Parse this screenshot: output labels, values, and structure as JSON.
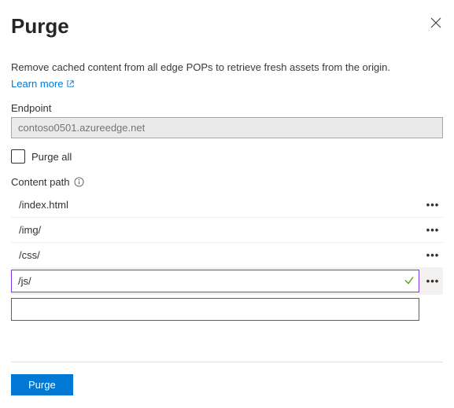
{
  "header": {
    "title": "Purge"
  },
  "description": "Remove cached content from all edge POPs to retrieve fresh assets from the origin.",
  "learn_more": "Learn more",
  "endpoint": {
    "label": "Endpoint",
    "value": "contoso0501.azureedge.net"
  },
  "purge_all": {
    "label": "Purge all",
    "checked": false
  },
  "content_path": {
    "label": "Content path",
    "rows": [
      {
        "value": "/index.html",
        "editing": false
      },
      {
        "value": "/img/",
        "editing": false
      },
      {
        "value": "/css/",
        "editing": false
      },
      {
        "value": "/js/",
        "editing": true,
        "valid": true
      }
    ],
    "blank": ""
  },
  "footer": {
    "purge_button": "Purge"
  }
}
